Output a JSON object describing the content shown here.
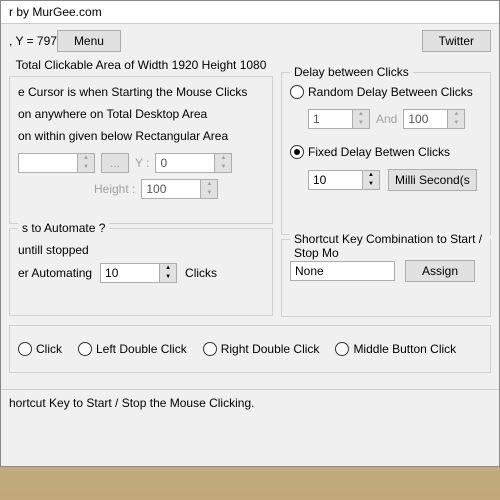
{
  "title": "r by MurGee.com",
  "coords": ", Y = 797",
  "menu_btn": "Menu",
  "twitter_btn": "Twitter",
  "clickable_area": "Total Clickable Area of Width 1920 Height 1080",
  "cursor": {
    "header": "e Cursor is when Starting the Mouse Clicks",
    "opt_anywhere": "on anywhere on Total Desktop Area",
    "opt_rect": "on within given below Rectangular Area",
    "y_label": "Y :",
    "y_val": "0",
    "h_label": "Height :",
    "h_val": "100",
    "ellipsis": "..."
  },
  "automate": {
    "header": "s to Automate ?",
    "opt_until": " untill stopped",
    "opt_after": "er Automating",
    "count": "10",
    "clicks": "Clicks"
  },
  "delay": {
    "header": "Delay between Clicks",
    "random": "Random Delay Between Clicks",
    "rand_min": "1",
    "and": "And",
    "rand_max": "100",
    "fixed": "Fixed Delay Betwen Clicks",
    "fixed_val": "10",
    "unit": "Milli Second(s"
  },
  "shortcut": {
    "header": "Shortcut Key Combination to Start / Stop Mo",
    "value": "None",
    "assign": "Assign"
  },
  "clicktype": {
    "opt1": "Click",
    "opt2": "Left Double Click",
    "opt3": "Right Double Click",
    "opt4": "Middle Button Click"
  },
  "status": "hortcut Key to Start / Stop the Mouse Clicking."
}
